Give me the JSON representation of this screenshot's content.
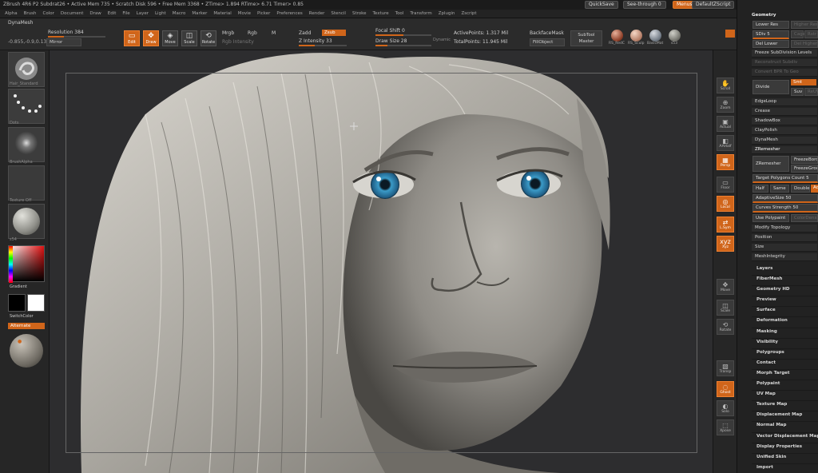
{
  "title_bar": {
    "text": "ZBrush 4R6 P2    Subdrat26    • Active Mem 735 • Scratch Disk 596 • Free Mem 3368 • ZTime> 1.894 RTime> 6.71 Timer> 0.85",
    "quicksave": "QuickSave",
    "seethrough": "See-through  0",
    "menus_btn": "Menus",
    "default_script": "DefaultZScript"
  },
  "menubar": {
    "items": [
      "Alpha",
      "Brush",
      "Color",
      "Document",
      "Draw",
      "Edit",
      "File",
      "Layer",
      "Light",
      "Macro",
      "Marker",
      "Material",
      "Movie",
      "Picker",
      "Preferences",
      "Render",
      "Stencil",
      "Stroke",
      "Texture",
      "Tool",
      "Transform",
      "Zplugin",
      "Zscript"
    ]
  },
  "shelf": {
    "dynamesh": "DynaMesh",
    "coords": "-0.855,-0.9,0.133",
    "resolution": "Resolution 384",
    "mirror": "Mirror",
    "tools": [
      "Edit",
      "Draw",
      "Move",
      "Scale",
      "Rotate"
    ],
    "mrgb": "Mrgb",
    "rgb": "Rgb",
    "m": "M",
    "rgb_intensity": "Rgb Intensity",
    "zadd": "Zadd",
    "zsub": "Zsub",
    "z_intensity": "Z Intensity 33",
    "focal_shift": "Focal Shift 0",
    "draw_size": "Draw Size 28",
    "dynamic": "Dynamic",
    "active_points": "ActivePoints: 1.317 Mil",
    "total_points": "TotalPoints: 11.945 Mil",
    "backface_mask": "BackfaceMask",
    "fill_object": "FillObject",
    "subtool_master": "SubTool Master",
    "materials": [
      "RS_RedC",
      "RS_Sculp",
      "BasicMat",
      "s53"
    ]
  },
  "left_tray": {
    "brush_label": "Hair_Standard",
    "stroke_label": "Dots",
    "alpha_label": "BrushAlpha",
    "texture_label": "Texture Off",
    "material_label": "s54",
    "gradient": "Gradient",
    "switch_color": "SwitchColor",
    "alternate": "Alternate"
  },
  "right_shelf": {
    "buttons": [
      "Scroll",
      "Zoom",
      "Actual",
      "AAHalf",
      "Persp",
      "Floor",
      "Local",
      "L.Sym",
      "Xyz",
      "Move",
      "Scale",
      "Rotate",
      "Transp",
      "Ghost",
      "Solo",
      "Xpose"
    ]
  },
  "palette": {
    "header": "Geometry",
    "lower_res": "Lower Res",
    "higher_res": "Higher Res",
    "sdiv": "SDiv 5",
    "cage": "Cage",
    "rstr": "Rstr",
    "del_lower": "Del Lower",
    "del_higher": "Del Higher",
    "freeze_subdiv": "Freeze SubDivision Levels",
    "reconstruct": "Reconstruct Subdiv",
    "convert_bpr": "Convert BPR To Geo",
    "divide": "Divide",
    "smt": "Smt",
    "suv": "Suv",
    "rel": "ReUV",
    "edgeloop": "EdgeLoop",
    "crease": "Crease",
    "shadowbox": "ShadowBox",
    "claypolish": "ClayPolish",
    "dynamesh": "DynaMesh",
    "zremesher_header": "ZRemesher",
    "zremesher": "ZRemesher",
    "freeze_border": "FreezeBorder",
    "freeze_groups": "FreezeGroups",
    "target_poly": "Target Polygons Count 5",
    "half": "Half",
    "same": "Same",
    "double": "Double",
    "adapt": "Adapt",
    "adaptive_size": "AdaptiveSize 50",
    "curves_strength": "Curves Strength 50",
    "use_polypaint": "Use Polypaint",
    "color_density": "ColorDensity",
    "modify_topology": "Modify Topology",
    "position": "Position",
    "size": "Size",
    "mesh_integrity": "MeshIntegrity",
    "sections": [
      "Layers",
      "FiberMesh",
      "Geometry HD",
      "Preview",
      "Surface",
      "Deformation",
      "Masking",
      "Visibility",
      "Polygroups",
      "Contact",
      "Morph Target",
      "Polypaint",
      "UV Map",
      "Texture Map",
      "Displacement Map",
      "Normal Map",
      "Vector Displacement Map",
      "Display Properties",
      "Unified Skin",
      "Import"
    ]
  },
  "colors": {
    "accent": "#d0651a",
    "panel": "#262626",
    "canvas": "#2d2d2f"
  }
}
